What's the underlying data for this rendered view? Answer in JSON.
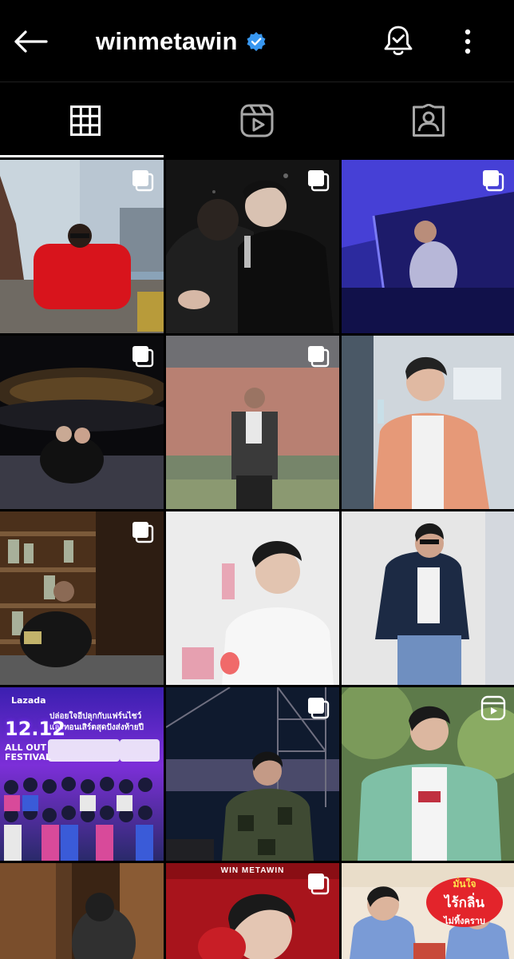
{
  "header": {
    "username": "winmetawin",
    "back_icon": "arrow-left-icon",
    "verified_icon": "verified-badge-icon",
    "notify_icon": "bell-check-icon",
    "more_icon": "more-vertical-icon"
  },
  "tabs": [
    {
      "id": "posts",
      "icon": "grid-icon",
      "selected": true
    },
    {
      "id": "reels",
      "icon": "reels-icon",
      "selected": false
    },
    {
      "id": "tagged",
      "icon": "tagged-person-icon",
      "selected": false
    }
  ],
  "grid": {
    "columns": 3,
    "posts": [
      {
        "overlay": "carousel-icon"
      },
      {
        "overlay": "carousel-icon"
      },
      {
        "overlay": "carousel-icon"
      },
      {
        "overlay": "carousel-icon"
      },
      {
        "overlay": "carousel-icon"
      },
      {
        "overlay": "none"
      },
      {
        "overlay": "carousel-icon"
      },
      {
        "overlay": "none"
      },
      {
        "overlay": "none"
      },
      {
        "overlay": "none"
      },
      {
        "overlay": "carousel-icon"
      },
      {
        "overlay": "reel-icon"
      },
      {
        "overlay": "none"
      },
      {
        "overlay": "carousel-icon"
      },
      {
        "overlay": "none"
      }
    ],
    "promo": {
      "brand": "Lazada",
      "headline": "ปล่อยใจอีปลุกกับแฟร์นไชว์\nและทอนเสิร์ตสุดปังส่งท้ายปี",
      "big": "12.12",
      "sub": "ALL OUT\nFESTIVAL"
    },
    "win_banner": "WIN METAWIN",
    "sticker": {
      "line1": "มั่นใจ",
      "line2": "ไร้กลิ่น",
      "line3": "ไม่ทิ้งคราบ"
    }
  },
  "colors": {
    "background": "#000000",
    "verified": "#3897f0",
    "tab_selected": "#ffffff",
    "tab_unselected": "#a8a8a8"
  }
}
